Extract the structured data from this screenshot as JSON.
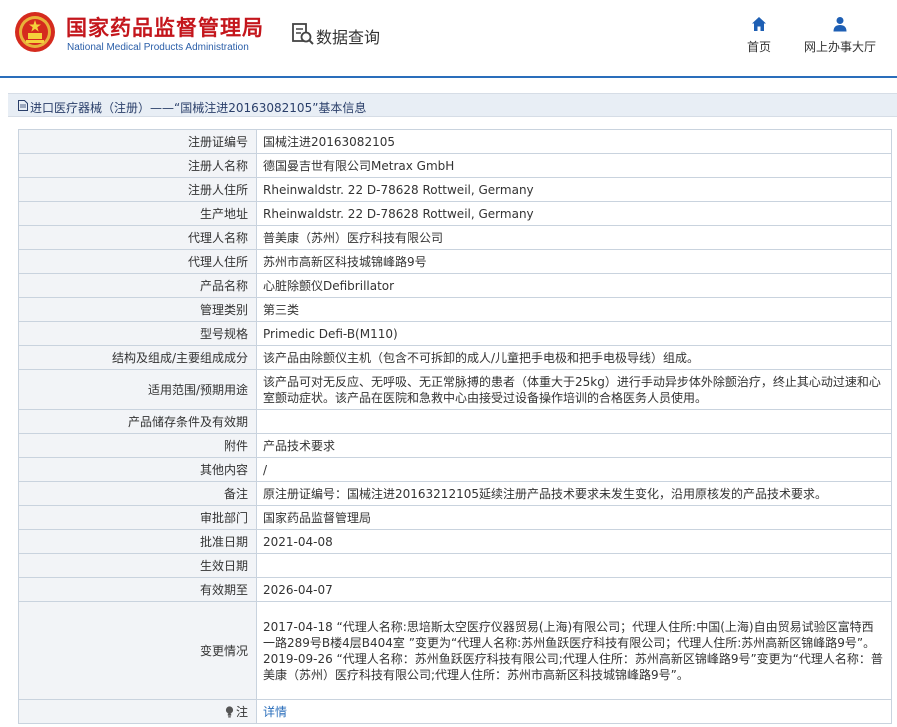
{
  "header": {
    "org_cn": "国家药品监督管理局",
    "org_en": "National Medical Products Administration",
    "query_title": "数据查询",
    "nav": {
      "home_label": "首页",
      "hall_label": "网上办事大厅"
    }
  },
  "breadcrumb": {
    "text": "进口医疗器械（注册）——“国械注进20163082105”基本信息"
  },
  "rows": [
    {
      "label": "注册证编号",
      "value": "国械注进20163082105"
    },
    {
      "label": "注册人名称",
      "value": "德国曼吉世有限公司Metrax GmbH"
    },
    {
      "label": "注册人住所",
      "value": "Rheinwaldstr. 22 D-78628 Rottweil, Germany"
    },
    {
      "label": "生产地址",
      "value": "Rheinwaldstr. 22 D-78628 Rottweil, Germany"
    },
    {
      "label": "代理人名称",
      "value": "普美康（苏州）医疗科技有限公司"
    },
    {
      "label": "代理人住所",
      "value": "苏州市高新区科技城锦峰路9号"
    },
    {
      "label": "产品名称",
      "value": "心脏除颤仪Defibrillator"
    },
    {
      "label": "管理类别",
      "value": "第三类"
    },
    {
      "label": "型号规格",
      "value": "Primedic Defi-B(M110)"
    },
    {
      "label": "结构及组成/主要组成成分",
      "value": "该产品由除颤仪主机（包含不可拆卸的成人/儿童把手电极和把手电极导线）组成。"
    },
    {
      "label": "适用范围/预期用途",
      "value": "该产品可对无反应、无呼吸、无正常脉搏的患者（体重大于25kg）进行手动异步体外除颤治疗，终止其心动过速和心室颤动症状。该产品在医院和急救中心由接受过设备操作培训的合格医务人员使用。"
    },
    {
      "label": "产品储存条件及有效期",
      "value": ""
    },
    {
      "label": "附件",
      "value": "产品技术要求"
    },
    {
      "label": "其他内容",
      "value": "/"
    },
    {
      "label": "备注",
      "value": "原注册证编号：国械注进20163212105延续注册产品技术要求未发生变化，沿用原核发的产品技术要求。"
    },
    {
      "label": "审批部门",
      "value": "国家药品监督管理局"
    },
    {
      "label": "批准日期",
      "value": "2021-04-08"
    },
    {
      "label": "生效日期",
      "value": ""
    },
    {
      "label": "有效期至",
      "value": "2026-04-07"
    }
  ],
  "changes": {
    "label": "变更情况",
    "entry1": "2017-04-18 “代理人名称:思培斯太空医疗仪器贸易(上海)有限公司；代理人住所:中国(上海)自由贸易试验区富特西一路289号B楼4层B404室 ”变更为“代理人名称:苏州鱼跃医疗科技有限公司；代理人住所:苏州高新区锦峰路9号”。",
    "entry2": "2019-09-26 “代理人名称：苏州鱼跃医疗科技有限公司;代理人住所：苏州高新区锦峰路9号”变更为“代理人名称：普美康（苏州）医疗科技有限公司;代理人住所：苏州市高新区科技城锦峰路9号”。"
  },
  "note": {
    "label": "注",
    "link": "详情"
  },
  "colors": {
    "brand_red": "#c4161c",
    "brand_blue": "#2a6ebb",
    "label_bg": "#f2f4f7",
    "border": "#c9d3de"
  }
}
